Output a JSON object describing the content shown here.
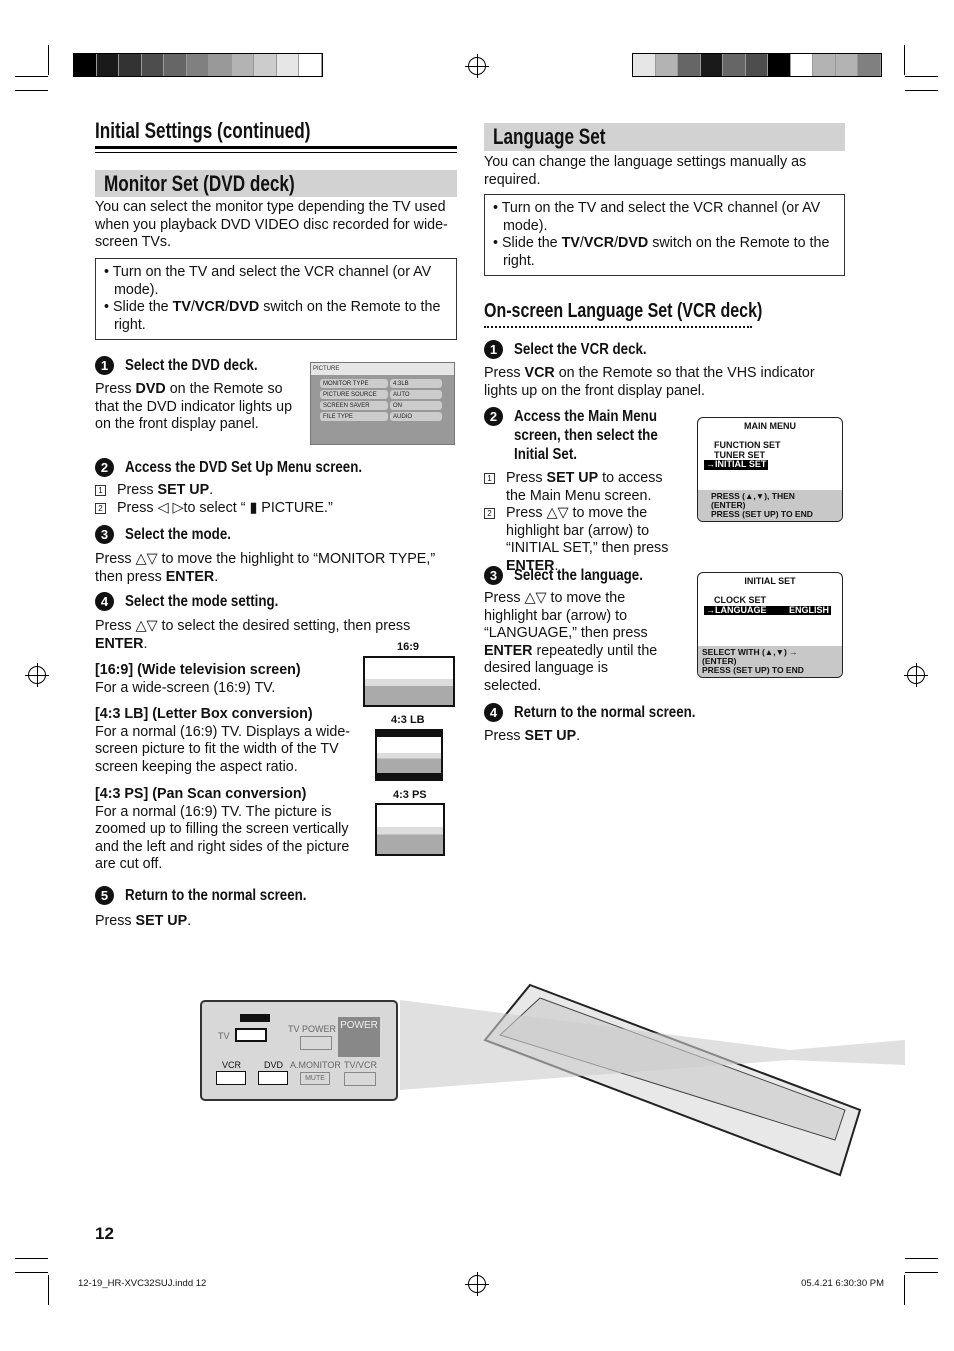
{
  "header": {
    "title": "Initial Settings (continued)"
  },
  "monitor": {
    "heading": "Monitor Set (DVD deck)",
    "intro": "You can select the monitor type depending the TV used when you playback DVD VIDEO disc recorded for wide-screen TVs.",
    "note": [
      [
        {
          "t": "Turn on the TV and select the VCR channel (or AV mode)."
        }
      ],
      [
        {
          "t": "Slide the "
        },
        {
          "t": "TV",
          "b": 1
        },
        {
          "t": "/"
        },
        {
          "t": "VCR",
          "b": 1
        },
        {
          "t": "/"
        },
        {
          "t": "DVD",
          "b": 1
        },
        {
          "t": " switch on the Remote to the right."
        }
      ]
    ],
    "step1": {
      "num": "1",
      "title": "Select the DVD deck.",
      "body": [
        {
          "t": "Press "
        },
        {
          "t": "DVD",
          "b": 1
        },
        {
          "t": " on the Remote so that the DVD indicator lights up on the front display panel."
        }
      ]
    },
    "picture_menu": {
      "title": "PICTURE",
      "rows": [
        [
          "MONITOR TYPE",
          "4:3LB"
        ],
        [
          "PICTURE SOURCE",
          "AUTO"
        ],
        [
          "SCREEN SAVER",
          "ON"
        ],
        [
          "FILE TYPE",
          "AUDIO"
        ]
      ]
    },
    "step2": {
      "num": "2",
      "title": "Access the DVD Set Up Menu screen.",
      "subs": [
        {
          "n": "1",
          "body": [
            {
              "t": "Press "
            },
            {
              "t": "SET UP",
              "b": 1
            },
            {
              "t": "."
            }
          ]
        },
        {
          "n": "2",
          "body": [
            {
              "t": "Press ◁ ▷to select “ "
            },
            {
              "t": "▮"
            },
            {
              "t": " PICTURE.”"
            }
          ]
        }
      ]
    },
    "step3": {
      "num": "3",
      "title": "Select the mode.",
      "body": [
        {
          "t": "Press △▽ to move the highlight to “MONITOR TYPE,” then press "
        },
        {
          "t": "ENTER",
          "b": 1
        },
        {
          "t": "."
        }
      ]
    },
    "step4": {
      "num": "4",
      "title": "Select the mode setting.",
      "body": [
        {
          "t": "Press △▽ to select the desired setting, then press "
        },
        {
          "t": "ENTER",
          "b": 1
        },
        {
          "t": "."
        }
      ]
    },
    "modes": [
      {
        "title": "[16:9] (Wide television screen)",
        "body": "For a wide-screen (16:9) TV.",
        "img_label": "16:9"
      },
      {
        "title": "[4:3 LB] (Letter Box conversion)",
        "body": "For a normal (16:9) TV. Displays a wide-screen picture to fit the width of the TV screen keeping the aspect ratio.",
        "img_label": "4:3 LB"
      },
      {
        "title": "[4:3 PS] (Pan Scan conversion)",
        "body": "For a normal (16:9) TV. The picture is zoomed up to filling the screen vertically and the left and right sides of the picture are cut off.",
        "img_label": "4:3 PS"
      }
    ],
    "step5": {
      "num": "5",
      "title": "Return to the normal screen.",
      "body": [
        {
          "t": "Press "
        },
        {
          "t": "SET UP",
          "b": 1
        },
        {
          "t": "."
        }
      ]
    }
  },
  "language": {
    "heading": "Language Set",
    "intro": "You can change the language settings manually as required.",
    "note": [
      [
        {
          "t": "Turn on the TV and select the VCR channel (or AV mode)."
        }
      ],
      [
        {
          "t": "Slide the "
        },
        {
          "t": "TV",
          "b": 1
        },
        {
          "t": "/"
        },
        {
          "t": "VCR",
          "b": 1
        },
        {
          "t": "/"
        },
        {
          "t": "DVD",
          "b": 1
        },
        {
          "t": " switch on the Remote to the right."
        }
      ]
    ],
    "subheading": "On-screen Language Set (VCR deck)",
    "step1": {
      "num": "1",
      "title": "Select the VCR deck.",
      "body": [
        {
          "t": "Press "
        },
        {
          "t": "VCR",
          "b": 1
        },
        {
          "t": " on the Remote so that the VHS indicator lights up on the front display panel."
        }
      ]
    },
    "step2": {
      "num": "2",
      "title_lines": [
        "Access the Main Menu",
        "screen, then select the",
        "Initial Set."
      ],
      "subs": [
        {
          "n": "1",
          "body": [
            {
              "t": "Press "
            },
            {
              "t": "SET UP",
              "b": 1
            },
            {
              "t": " to access the Main Menu screen."
            }
          ]
        },
        {
          "n": "2",
          "body": [
            {
              "t": "Press △▽ to move the highlight bar (arrow) to “INITIAL SET,”  then press "
            },
            {
              "t": "ENTER",
              "b": 1
            },
            {
              "t": "."
            }
          ]
        }
      ]
    },
    "main_menu": {
      "title": "MAIN MENU",
      "items": [
        "FUNCTION SET",
        "TUNER SET",
        "→INITIAL SET"
      ],
      "footer": [
        "PRESS (▲,▼), THEN (ENTER)",
        "PRESS (SET UP) TO END"
      ]
    },
    "step3": {
      "num": "3",
      "title": "Select the language.",
      "body": [
        {
          "t": "Press △▽ to move the highlight bar (arrow) to “LANGUAGE,” then press "
        },
        {
          "t": "ENTER",
          "b": 1
        },
        {
          "t": " repeatedly until the desired language is selected."
        }
      ]
    },
    "initial_set": {
      "title": "INITIAL SET",
      "items": [
        "CLOCK SET",
        "→LANGUAGE"
      ],
      "value": "ENGLISH",
      "footer": [
        "SELECT WITH (▲,▼) → (ENTER)",
        "PRESS (SET UP) TO END"
      ]
    },
    "step4": {
      "num": "4",
      "title": "Return to the normal screen.",
      "body": [
        {
          "t": "Press "
        },
        {
          "t": "SET UP",
          "b": 1
        },
        {
          "t": "."
        }
      ]
    }
  },
  "remote_panel": {
    "tv": "TV",
    "tv_power": "TV POWER",
    "power": "POWER",
    "vcr": "VCR",
    "dvd": "DVD",
    "a_monitor": "A.MONITOR",
    "mute": "MUTE",
    "tv_vcr": "TV/VCR"
  },
  "page_number": "12",
  "footer": {
    "file": "12-19_HR-XVC32SUJ.indd   12",
    "date": "05.4.21   6:30:30 PM"
  },
  "color_bars": {
    "left": [
      "#000000",
      "#1a1a1a",
      "#333333",
      "#4d4d4d",
      "#666666",
      "#808080",
      "#999999",
      "#b3b3b3",
      "#cccccc",
      "#e6e6e6",
      "#ffffff"
    ],
    "right": [
      "#e6e6e6",
      "#b3b3b3",
      "#666666",
      "#1a1a1a",
      "#666666",
      "#4d4d4d",
      "#000000",
      "#ffffff",
      "#b3b3b3",
      "#b3b3b3",
      "#808080"
    ]
  }
}
